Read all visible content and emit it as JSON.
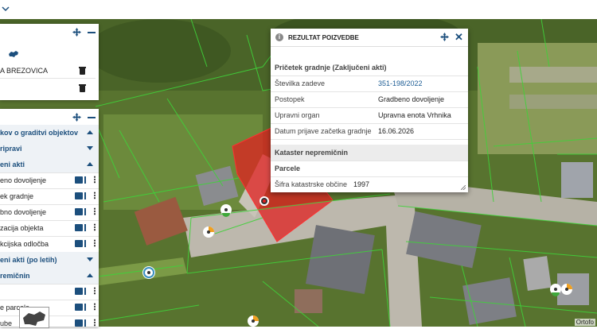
{
  "popup": {
    "title": "REZULTAT POIZVEDBE",
    "section_title": "Pričetek gradnje (Zaključeni akti)",
    "rows": [
      {
        "key": "Številka zadeve",
        "value": "351-198/2022"
      },
      {
        "key": "Postopek",
        "value": "Gradbeno dovoljenje"
      },
      {
        "key": "Upravni organ",
        "value": "Upravna enota Vrhnika"
      },
      {
        "key": "Datum prijave začetka gradnje",
        "value": "16.06.2026"
      }
    ],
    "kataster": "Kataster nepremičnin",
    "parcele": "Parcele",
    "sifra_label": "Šifra katastrske občine",
    "sifra_value": "1997"
  },
  "panel_top": {
    "place": "A BREZOVICA"
  },
  "panel_layers": {
    "items": [
      {
        "label": "kov o graditvi objektov",
        "kind": "header",
        "caret": "up"
      },
      {
        "label": "ripravi",
        "kind": "header",
        "caret": "down"
      },
      {
        "label": "eni akti",
        "kind": "header",
        "caret": "up"
      },
      {
        "label": "eno dovoljenje",
        "kind": "layer"
      },
      {
        "label": "ek gradnje",
        "kind": "layer"
      },
      {
        "label": "bno dovoljenje",
        "kind": "layer"
      },
      {
        "label": "zacija objekta",
        "kind": "layer"
      },
      {
        "label": "kcijska odločba",
        "kind": "layer"
      },
      {
        "label": "eni akti (po letih)",
        "kind": "header",
        "caret": "down"
      },
      {
        "label": "remičnin",
        "kind": "header",
        "caret": "up"
      },
      {
        "label": "",
        "kind": "layer"
      },
      {
        "label": "e parcele",
        "kind": "layer"
      },
      {
        "label": "ube",
        "kind": "layer"
      }
    ]
  },
  "map": {
    "attribution": "Ortofo",
    "parcel_color": "#e02020",
    "boundary_color": "#3fd13a"
  }
}
